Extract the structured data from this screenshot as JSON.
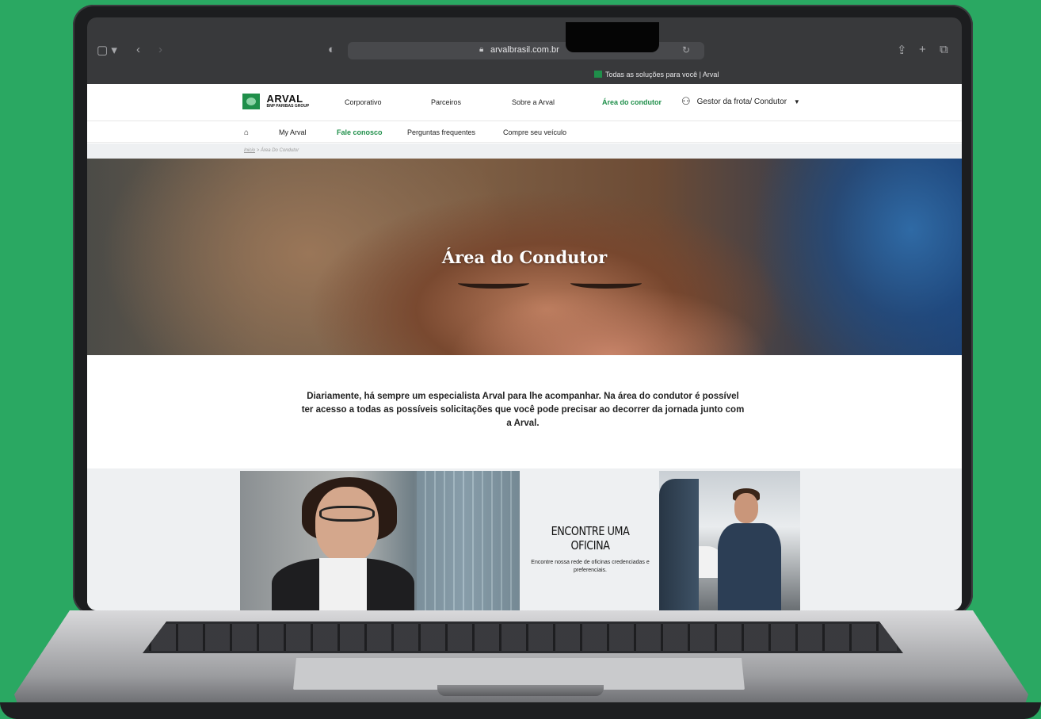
{
  "browser": {
    "url": "arvalbrasil.com.br",
    "tab_title": "Todas as soluções para você | Arval"
  },
  "header": {
    "logo_name": "ARVAL",
    "logo_sub": "BNP PARIBAS GROUP",
    "nav": [
      "Corporativo",
      "Parceiros",
      "Sobre a Arval",
      "Área do condutor"
    ],
    "active_nav": "Área do condutor",
    "user_menu": "Gestor da frota/ Condutor"
  },
  "subnav": {
    "items": [
      "My Arval",
      "Fale conosco",
      "Perguntas frequentes",
      "Compre seu veículo"
    ],
    "active": "Fale conosco"
  },
  "breadcrumb": {
    "home": "Inicio",
    "separator": ">",
    "current": "Área Do Condutor"
  },
  "hero": {
    "title": "Área do Condutor"
  },
  "intro": {
    "text": "Diariamente, há sempre um especialista Arval para lhe acompanhar. Na área do condutor é possível ter acesso a todas as possíveis solicitações que você pode precisar ao decorrer da jornada junto com a Arval."
  },
  "card_oficina": {
    "title": "ENCONTRE UMA OFICINA",
    "description": "Encontre nossa rede de oficinas credenciadas e preferenciais."
  },
  "colors": {
    "brand_green": "#1f8f4a",
    "background_green": "#2aa862",
    "light_gray": "#eef0f2"
  }
}
